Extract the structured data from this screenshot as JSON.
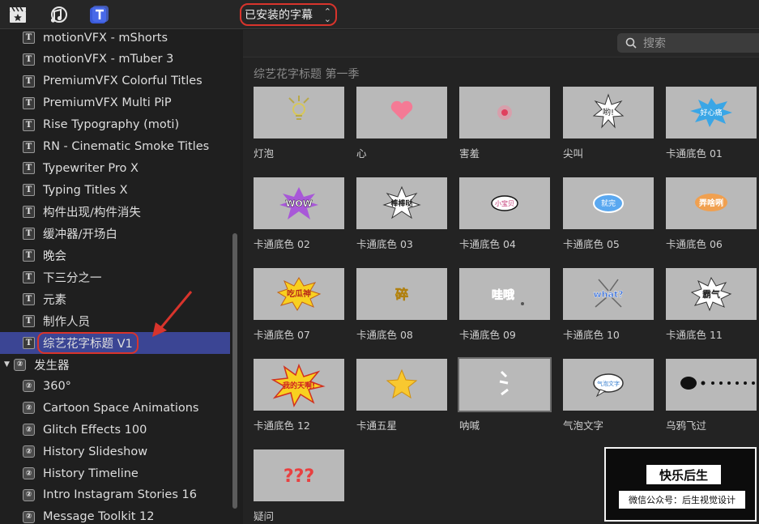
{
  "topbar": {
    "icons": [
      "clapper-star-icon",
      "music-photo-icon",
      "title-t-icon"
    ],
    "browser_label": "已安装的字幕",
    "browser_chevron": "⌃⌄"
  },
  "sidebar": {
    "items": [
      {
        "label": "motionVFX - mShorts",
        "type": "title"
      },
      {
        "label": "motionVFX - mTuber 3",
        "type": "title"
      },
      {
        "label": "PremiumVFX Colorful Titles",
        "type": "title"
      },
      {
        "label": "PremiumVFX Multi PiP",
        "type": "title"
      },
      {
        "label": "Rise Typography (moti)",
        "type": "title"
      },
      {
        "label": "RN - Cinematic Smoke Titles",
        "type": "title"
      },
      {
        "label": "Typewriter Pro X",
        "type": "title"
      },
      {
        "label": "Typing Titles X",
        "type": "title"
      },
      {
        "label": "构件出现/构件消失",
        "type": "title"
      },
      {
        "label": "缓冲器/开场白",
        "type": "title"
      },
      {
        "label": "晚会",
        "type": "title"
      },
      {
        "label": "下三分之一",
        "type": "title"
      },
      {
        "label": "元素",
        "type": "title"
      },
      {
        "label": "制作人员",
        "type": "title"
      },
      {
        "label": "综艺花字标题 V1",
        "type": "title",
        "selected": true
      },
      {
        "label": "发生器",
        "type": "group"
      },
      {
        "label": "360°",
        "type": "generator"
      },
      {
        "label": "Cartoon Space Animations",
        "type": "generator"
      },
      {
        "label": "Glitch Effects 100",
        "type": "generator"
      },
      {
        "label": "History Slideshow",
        "type": "generator"
      },
      {
        "label": "History Timeline",
        "type": "generator"
      },
      {
        "label": "Intro Instagram Stories 16",
        "type": "generator"
      },
      {
        "label": "Message Toolkit 12",
        "type": "generator"
      }
    ],
    "title_glyph": "T",
    "generator_glyph": "②",
    "disclosure": "▼"
  },
  "search": {
    "placeholder": "搜索"
  },
  "section": {
    "title": "综艺花字标题 第一季"
  },
  "tiles": [
    {
      "label": "灯泡"
    },
    {
      "label": "心"
    },
    {
      "label": "害羞"
    },
    {
      "label": "尖叫"
    },
    {
      "label": "卡通底色 01"
    },
    {
      "label": "卡通底色 02"
    },
    {
      "label": "卡通底色 03"
    },
    {
      "label": "卡通底色 04"
    },
    {
      "label": "卡通底色 05"
    },
    {
      "label": "卡通底色 06"
    },
    {
      "label": "卡通底色 07"
    },
    {
      "label": "卡通底色 08"
    },
    {
      "label": "卡通底色 09"
    },
    {
      "label": "卡通底色 10"
    },
    {
      "label": "卡通底色 11"
    },
    {
      "label": "卡通底色 12"
    },
    {
      "label": "卡通五星"
    },
    {
      "label": "呐喊"
    },
    {
      "label": "气泡文字"
    },
    {
      "label": "乌鸦飞过"
    },
    {
      "label": "疑问"
    }
  ],
  "thumb_text": {
    "t4": "哟!",
    "t5": "好心痛",
    "t6": "WOW",
    "t7": "棒棒哒",
    "t8": "小宝贝",
    "t9": "就完",
    "t10": "弄啥咧",
    "t11": "吃瓜神",
    "t12": "碎",
    "t13": "哇哦",
    "t14": "what?",
    "t15": "霸气",
    "t16": "我的天啊!",
    "t19": "气泡文字",
    "t21": "???"
  },
  "watermark": {
    "title": "快乐后生",
    "subtitle": "微信公众号：后生视觉设计"
  },
  "colors": {
    "accent_red": "#d8342c",
    "selection": "#3b4594"
  }
}
